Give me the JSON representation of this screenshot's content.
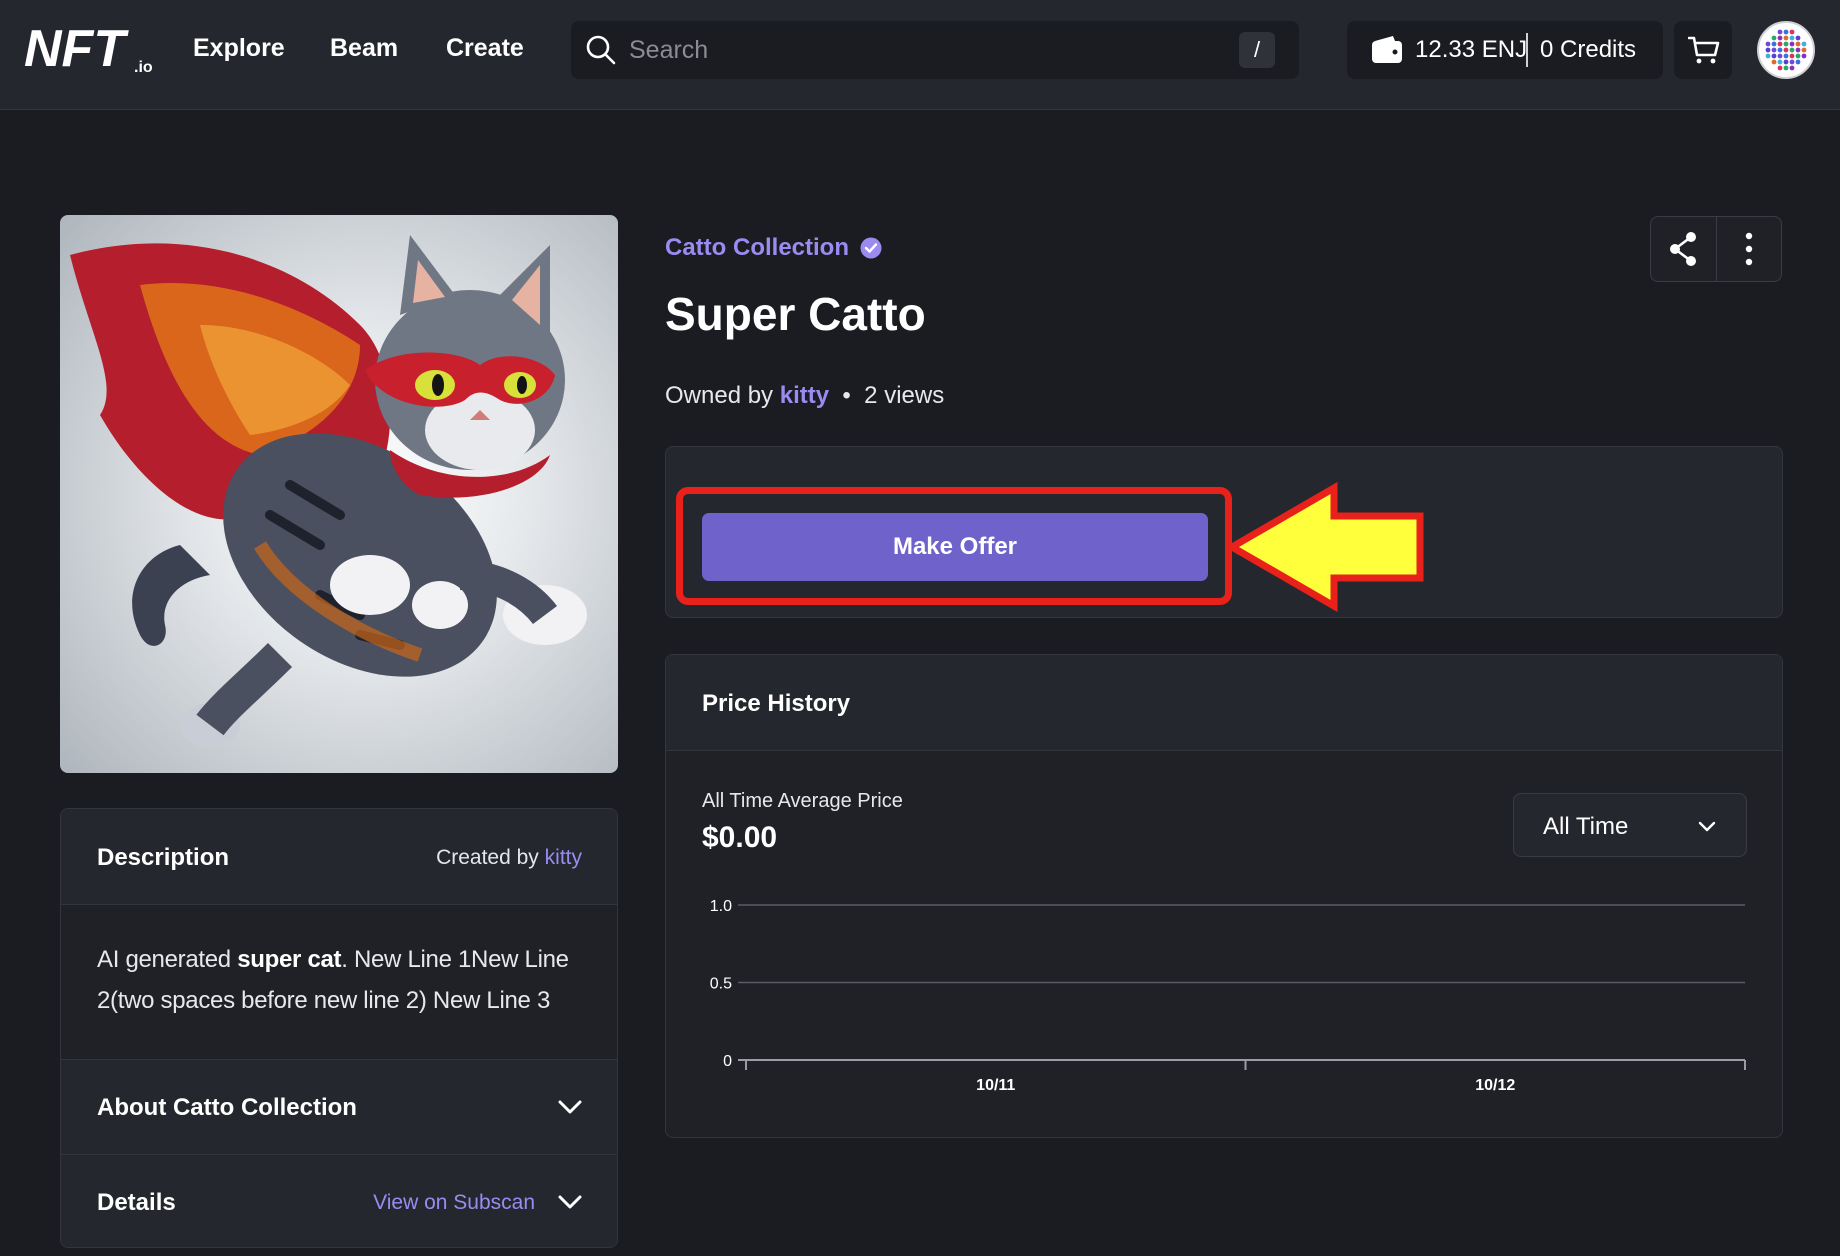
{
  "header": {
    "logo_text": "NFT.io",
    "nav": [
      "Explore",
      "Beam",
      "Create"
    ],
    "search_placeholder": "Search",
    "search_shortcut": "/",
    "wallet_balance": "12.33 ENJ",
    "credits": "0 Credits"
  },
  "nft": {
    "collection": "Catto Collection",
    "title": "Super Catto",
    "owned_by_prefix": "Owned by",
    "owner": "kitty",
    "views": "2 views"
  },
  "offer": {
    "button_label": "Make Offer"
  },
  "description": {
    "title": "Description",
    "created_by_prefix": "Created by",
    "creator": "kitty",
    "text_before": "AI generated ",
    "text_bold": "super cat",
    "text_after": ". New Line 1New Line 2(two spaces before new line 2) New Line 3",
    "about_title": "About Catto Collection",
    "details_title": "Details",
    "subscan_link": "View on Subscan"
  },
  "price_history": {
    "title": "Price History",
    "avg_label": "All Time Average Price",
    "avg_value": "$0.00",
    "range": "All Time"
  },
  "chart_data": {
    "type": "line",
    "x": [
      "10/11",
      "10/12"
    ],
    "series": [],
    "yticks": [
      "0",
      "0.5",
      "1.0"
    ],
    "ylim": [
      0,
      1.0
    ],
    "grid": true
  },
  "colors": {
    "accent": "#9b8bf0",
    "button": "#6f63cb",
    "highlight_box": "#e8221b",
    "arrow": "#ffff3c"
  }
}
